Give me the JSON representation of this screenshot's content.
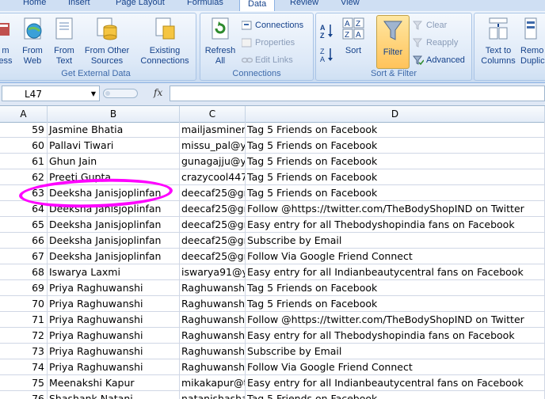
{
  "tabs": [
    "Home",
    "Insert",
    "Page Layout",
    "Formulas",
    "Data",
    "Review",
    "View"
  ],
  "active_tab": "Data",
  "ribbon": {
    "get_external": {
      "label": "Get External Data",
      "access": "m\ness",
      "web": "From\nWeb",
      "text": "From\nText",
      "other": "From Other\nSources",
      "existing": "Existing\nConnections"
    },
    "connections": {
      "label": "Connections",
      "refresh": "Refresh\nAll",
      "items": [
        "Connections",
        "Properties",
        "Edit Links"
      ]
    },
    "sort_filter": {
      "label": "Sort & Filter",
      "sort": "Sort",
      "filter": "Filter",
      "clear": "Clear",
      "reapply": "Reapply",
      "advanced": "Advanced"
    },
    "data_tools": {
      "text_to_columns": "Text to\nColumns",
      "remove_dup": "Remo\nDuplic"
    }
  },
  "formula_bar": {
    "name_box": "L47",
    "fx": "fx",
    "value": ""
  },
  "columns": [
    "A",
    "B",
    "C",
    "D"
  ],
  "rows": [
    {
      "a": "59",
      "b": "Jasmine Bhatia",
      "c": "mailjasminer",
      "d": "Tag 5 Friends on Facebook"
    },
    {
      "a": "60",
      "b": "Pallavi Tiwari",
      "c": "missu_pal@y",
      "d": "Tag 5 Friends on Facebook"
    },
    {
      "a": "61",
      "b": "Ghun Jain",
      "c": "gunagajju@y",
      "d": "Tag 5 Friends on Facebook"
    },
    {
      "a": "62",
      "b": "Preeti Gupta",
      "c": "crazycool447",
      "d": "Tag 5 Friends on Facebook"
    },
    {
      "a": "63",
      "b": "Deeksha Janisjoplinfan",
      "c": "deecaf25@gr",
      "d": "Tag 5 Friends on Facebook"
    },
    {
      "a": "64",
      "b": "Deeksha Janisjoplinfan",
      "c": "deecaf25@gr",
      "d": "Follow @https://twitter.com/TheBodyShopIND on Twitter"
    },
    {
      "a": "65",
      "b": "Deeksha Janisjoplinfan",
      "c": "deecaf25@gr",
      "d": "Easy entry for all Thebodyshopindia fans on Facebook"
    },
    {
      "a": "66",
      "b": "Deeksha Janisjoplinfan",
      "c": "deecaf25@gr",
      "d": "Subscribe by Email"
    },
    {
      "a": "67",
      "b": "Deeksha Janisjoplinfan",
      "c": "deecaf25@gr",
      "d": "Follow Via Google Friend Connect"
    },
    {
      "a": "68",
      "b": "Iswarya Laxmi",
      "c": "iswarya91@y",
      "d": "Easy entry for all Indianbeautycentral fans on Facebook"
    },
    {
      "a": "69",
      "b": "Priya Raghuwanshi",
      "c": "Raghuwanshi",
      "d": "Tag 5 Friends on Facebook"
    },
    {
      "a": "70",
      "b": "Priya Raghuwanshi",
      "c": "Raghuwanshi",
      "d": "Tag 5 Friends on Facebook"
    },
    {
      "a": "71",
      "b": "Priya Raghuwanshi",
      "c": "Raghuwanshi",
      "d": "Follow @https://twitter.com/TheBodyShopIND on Twitter"
    },
    {
      "a": "72",
      "b": "Priya Raghuwanshi",
      "c": "Raghuwanshi",
      "d": "Easy entry for all Thebodyshopindia fans on Facebook"
    },
    {
      "a": "73",
      "b": "Priya Raghuwanshi",
      "c": "Raghuwanshi",
      "d": "Subscribe by Email"
    },
    {
      "a": "74",
      "b": "Priya Raghuwanshi",
      "c": "Raghuwanshi",
      "d": "Follow Via Google Friend Connect"
    },
    {
      "a": "75",
      "b": "Meenakshi Kapur",
      "c": "mikakapur@t",
      "d": "Easy entry for all Indianbeautycentral fans on Facebook"
    },
    {
      "a": "76",
      "b": "Shashank Natani",
      "c": "natanishashank",
      "d": "Tag 5 Friends on Facebook"
    }
  ],
  "highlight_color": "#ff00ff",
  "accent": "#15428b"
}
